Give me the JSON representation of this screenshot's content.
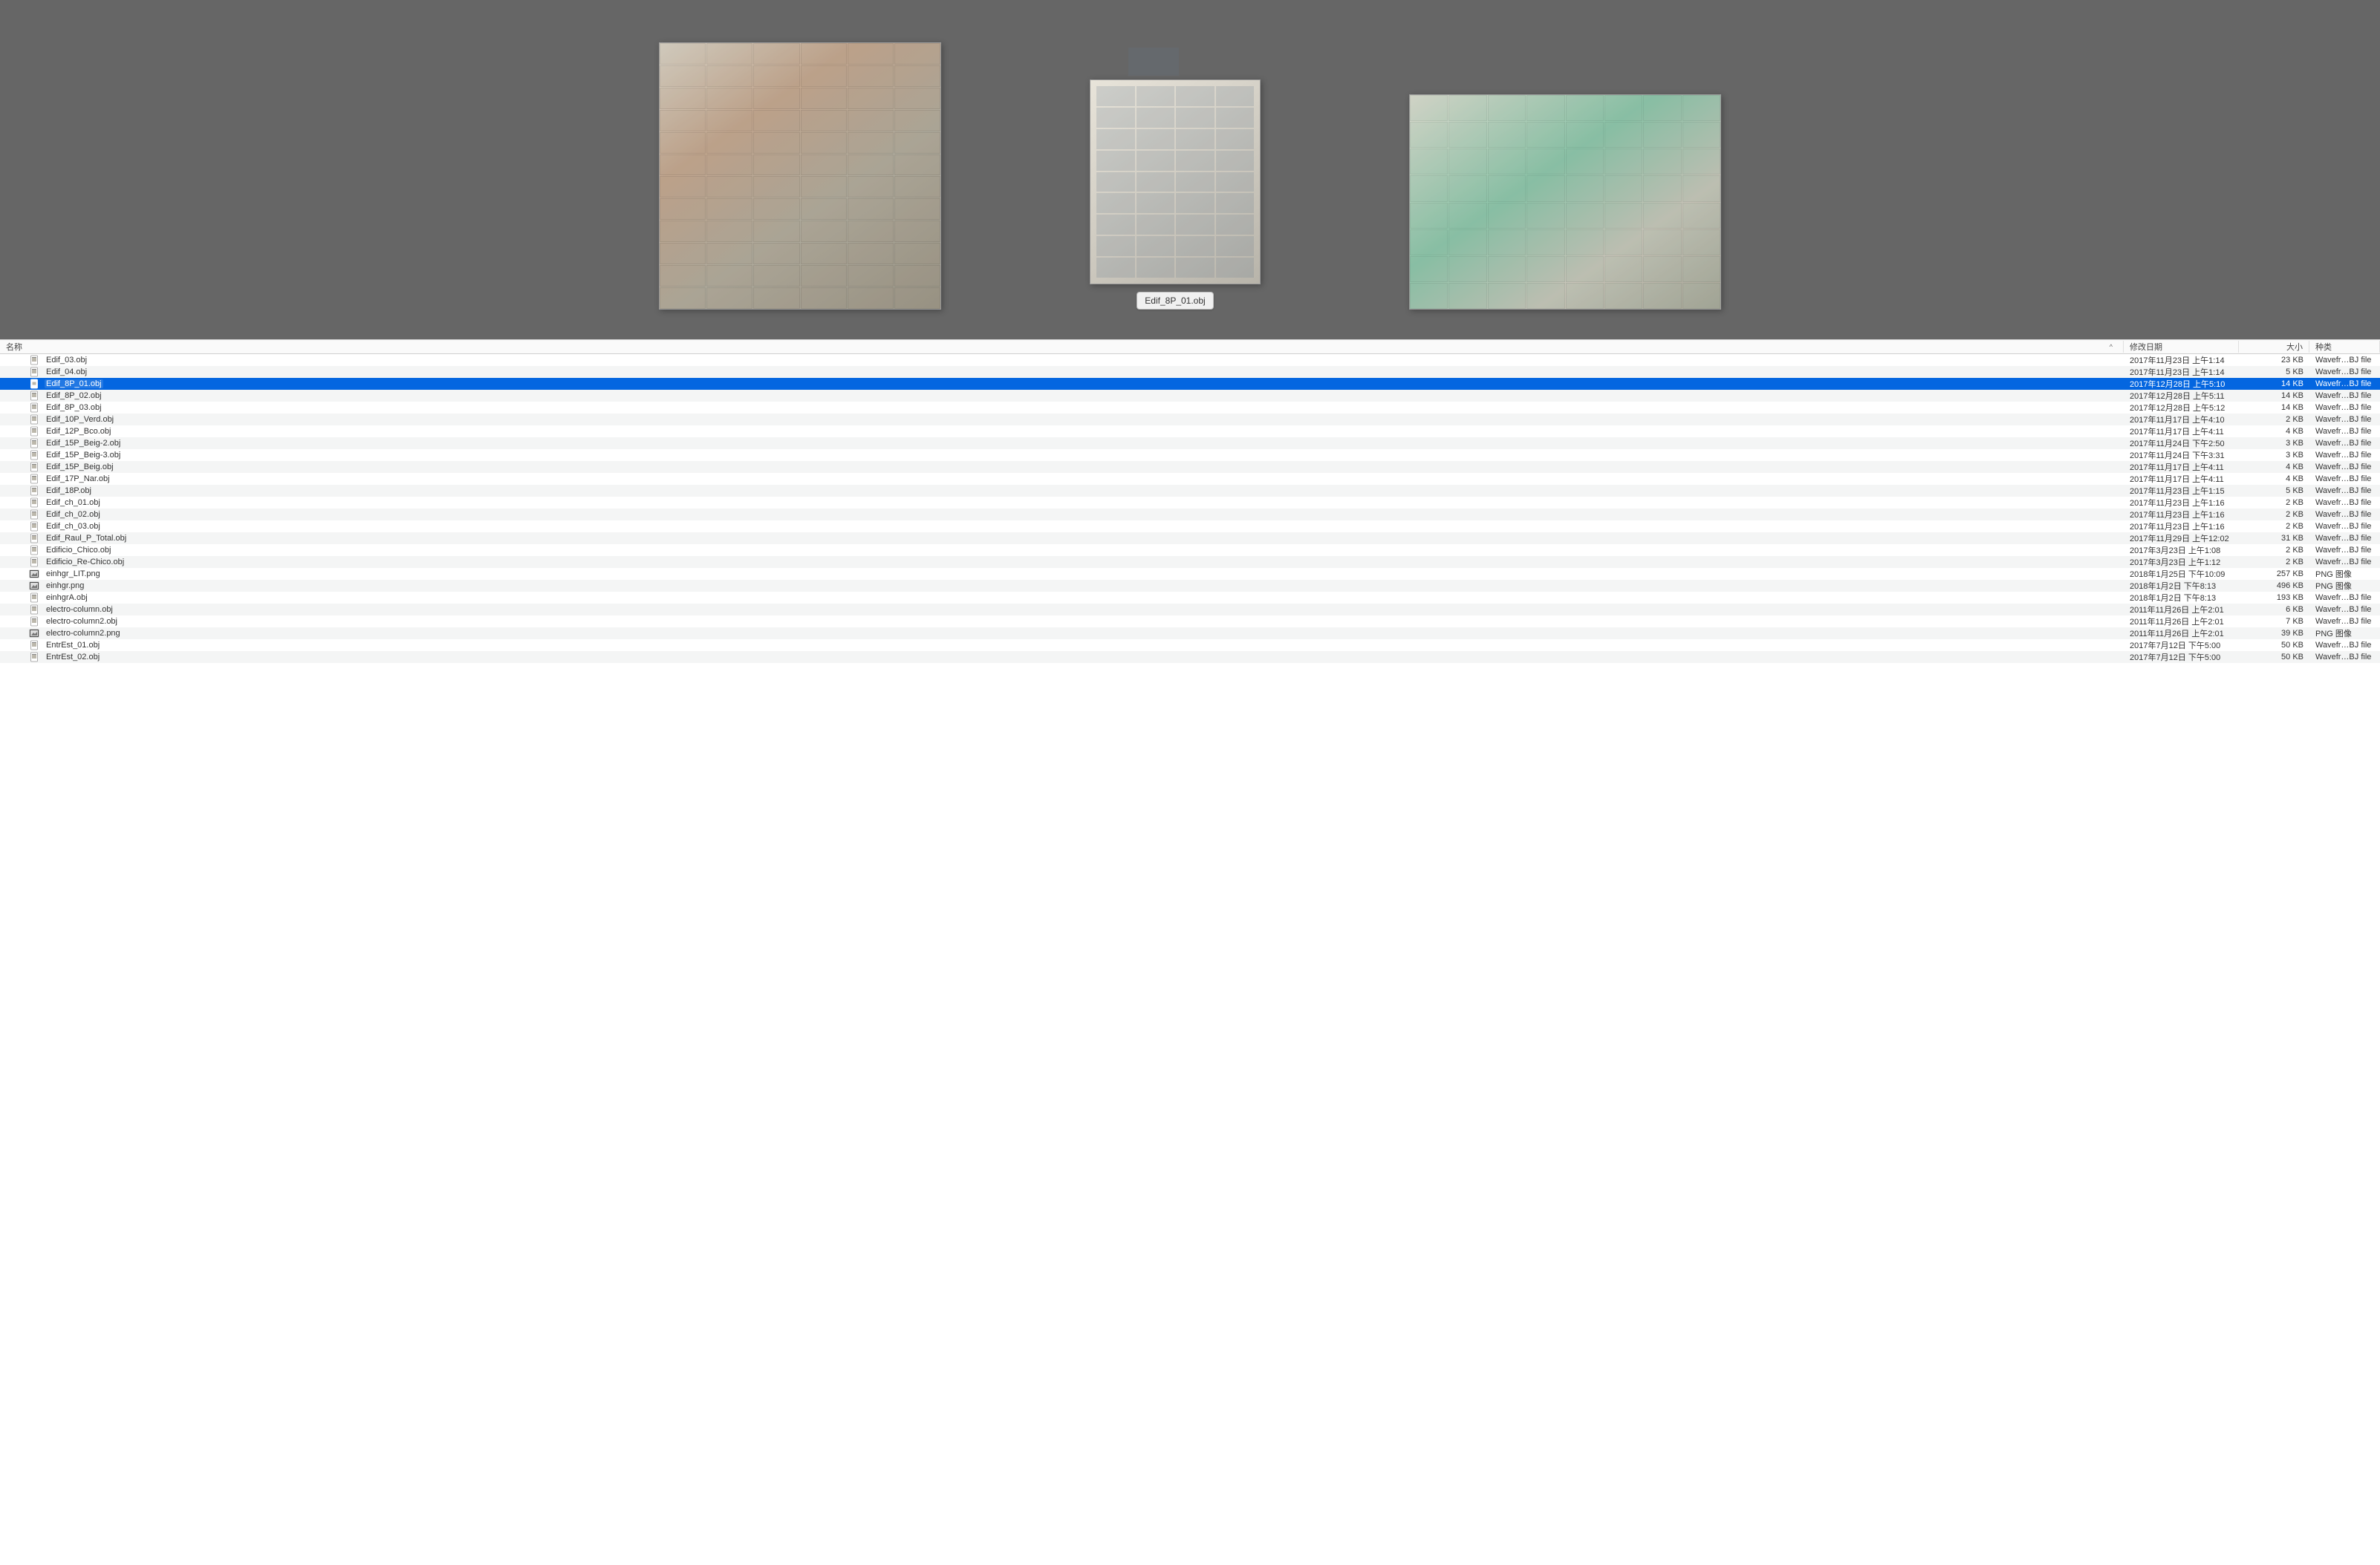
{
  "preview": {
    "center_label": "Edif_8P_01.obj"
  },
  "columns": {
    "name": "名称",
    "date": "修改日期",
    "size": "大小",
    "kind": "种类",
    "sort_indicator": "^"
  },
  "files": [
    {
      "icon": "obj",
      "name": "Edif_03.obj",
      "date": "2017年11月23日 上午1:14",
      "size": "23 KB",
      "kind": "Wavefr…BJ file",
      "selected": false
    },
    {
      "icon": "obj",
      "name": "Edif_04.obj",
      "date": "2017年11月23日 上午1:14",
      "size": "5 KB",
      "kind": "Wavefr…BJ file",
      "selected": false
    },
    {
      "icon": "obj",
      "name": "Edif_8P_01.obj",
      "date": "2017年12月28日 上午5:10",
      "size": "14 KB",
      "kind": "Wavefr…BJ file",
      "selected": true
    },
    {
      "icon": "obj",
      "name": "Edif_8P_02.obj",
      "date": "2017年12月28日 上午5:11",
      "size": "14 KB",
      "kind": "Wavefr…BJ file",
      "selected": false
    },
    {
      "icon": "obj",
      "name": "Edif_8P_03.obj",
      "date": "2017年12月28日 上午5:12",
      "size": "14 KB",
      "kind": "Wavefr…BJ file",
      "selected": false
    },
    {
      "icon": "obj",
      "name": "Edif_10P_Verd.obj",
      "date": "2017年11月17日 上午4:10",
      "size": "2 KB",
      "kind": "Wavefr…BJ file",
      "selected": false
    },
    {
      "icon": "obj",
      "name": "Edif_12P_Bco.obj",
      "date": "2017年11月17日 上午4:11",
      "size": "4 KB",
      "kind": "Wavefr…BJ file",
      "selected": false
    },
    {
      "icon": "obj",
      "name": "Edif_15P_Beig-2.obj",
      "date": "2017年11月24日 下午2:50",
      "size": "3 KB",
      "kind": "Wavefr…BJ file",
      "selected": false
    },
    {
      "icon": "obj",
      "name": "Edif_15P_Beig-3.obj",
      "date": "2017年11月24日 下午3:31",
      "size": "3 KB",
      "kind": "Wavefr…BJ file",
      "selected": false
    },
    {
      "icon": "obj",
      "name": "Edif_15P_Beig.obj",
      "date": "2017年11月17日 上午4:11",
      "size": "4 KB",
      "kind": "Wavefr…BJ file",
      "selected": false
    },
    {
      "icon": "obj",
      "name": "Edif_17P_Nar.obj",
      "date": "2017年11月17日 上午4:11",
      "size": "4 KB",
      "kind": "Wavefr…BJ file",
      "selected": false
    },
    {
      "icon": "obj",
      "name": "Edif_18P.obj",
      "date": "2017年11月23日 上午1:15",
      "size": "5 KB",
      "kind": "Wavefr…BJ file",
      "selected": false
    },
    {
      "icon": "obj",
      "name": "Edif_ch_01.obj",
      "date": "2017年11月23日 上午1:16",
      "size": "2 KB",
      "kind": "Wavefr…BJ file",
      "selected": false
    },
    {
      "icon": "obj",
      "name": "Edif_ch_02.obj",
      "date": "2017年11月23日 上午1:16",
      "size": "2 KB",
      "kind": "Wavefr…BJ file",
      "selected": false
    },
    {
      "icon": "obj",
      "name": "Edif_ch_03.obj",
      "date": "2017年11月23日 上午1:16",
      "size": "2 KB",
      "kind": "Wavefr…BJ file",
      "selected": false
    },
    {
      "icon": "obj",
      "name": "Edif_Raul_P_Total.obj",
      "date": "2017年11月29日 上午12:02",
      "size": "31 KB",
      "kind": "Wavefr…BJ file",
      "selected": false
    },
    {
      "icon": "obj",
      "name": "Edificio_Chico.obj",
      "date": "2017年3月23日 上午1:08",
      "size": "2 KB",
      "kind": "Wavefr…BJ file",
      "selected": false
    },
    {
      "icon": "obj",
      "name": "Edificio_Re-Chico.obj",
      "date": "2017年3月23日 上午1:12",
      "size": "2 KB",
      "kind": "Wavefr…BJ file",
      "selected": false
    },
    {
      "icon": "png",
      "name": "einhgr_LIT.png",
      "date": "2018年1月25日 下午10:09",
      "size": "257 KB",
      "kind": "PNG 图像",
      "selected": false
    },
    {
      "icon": "png",
      "name": "einhgr.png",
      "date": "2018年1月2日 下午8:13",
      "size": "496 KB",
      "kind": "PNG 图像",
      "selected": false
    },
    {
      "icon": "obj",
      "name": "einhgrA.obj",
      "date": "2018年1月2日 下午8:13",
      "size": "193 KB",
      "kind": "Wavefr…BJ file",
      "selected": false
    },
    {
      "icon": "obj",
      "name": "electro-column.obj",
      "date": "2011年11月26日 上午2:01",
      "size": "6 KB",
      "kind": "Wavefr…BJ file",
      "selected": false
    },
    {
      "icon": "obj",
      "name": "electro-column2.obj",
      "date": "2011年11月26日 上午2:01",
      "size": "7 KB",
      "kind": "Wavefr…BJ file",
      "selected": false
    },
    {
      "icon": "png",
      "name": "electro-column2.png",
      "date": "2011年11月26日 上午2:01",
      "size": "39 KB",
      "kind": "PNG 图像",
      "selected": false
    },
    {
      "icon": "obj",
      "name": "EntrEst_01.obj",
      "date": "2017年7月12日 下午5:00",
      "size": "50 KB",
      "kind": "Wavefr…BJ file",
      "selected": false
    },
    {
      "icon": "obj",
      "name": "EntrEst_02.obj",
      "date": "2017年7月12日 下午5:00",
      "size": "50 KB",
      "kind": "Wavefr…BJ file",
      "selected": false
    }
  ]
}
